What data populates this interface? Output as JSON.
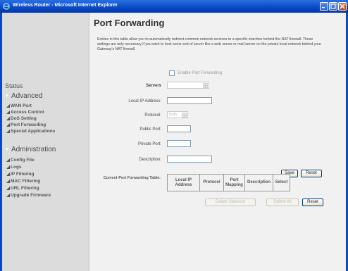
{
  "window": {
    "title": "Wireless Router - Microsoft Internet Explorer"
  },
  "sidebar": {
    "status_label": "Status",
    "advanced": {
      "label": "Advanced",
      "items": [
        "WAN Port",
        "Access Control",
        "DoS Setting",
        "Port Forwarding",
        "Special Applications"
      ]
    },
    "administration": {
      "label": "Administration",
      "items": [
        "Config File",
        "Logs",
        "IP Filtering",
        "MAC Filtering",
        "URL Filtering",
        "Upgrade Firmware"
      ]
    }
  },
  "main": {
    "title": "Port Forwarding",
    "description": "Entries in this table allow you to automatically redirect common network services to a specific machine behind the NAT firewall. These settings are only necessary if you wish to host some sort of server like a web server or mail server on the private local network behind your Gateway's NAT firewall.",
    "enable_label": "Enable Port Forwarding",
    "enable_checked": false,
    "form": {
      "servers_label": "Servers",
      "servers_value": "",
      "local_ip_label": "Local IP Address:",
      "local_ip_value": "",
      "protocol_label": "Protocol:",
      "protocol_value": "Both",
      "public_port_label": "Public Port:",
      "public_port_value": "",
      "private_port_label": "Private Port:",
      "private_port_value": "",
      "description_label": "Description:",
      "description_value": ""
    },
    "save_label": "Save",
    "reset_label": "Reset",
    "table": {
      "label": "Current Port Forwarding Table:",
      "columns": [
        "Local IP Address",
        "Protocol",
        "Port Mapping",
        "Description",
        "Select"
      ]
    },
    "delete_selected_label": "Delete Selected",
    "delete_all_label": "Delete All",
    "table_reset_label": "Reset"
  },
  "colors": {
    "titlebar": "#0a4ac7",
    "sidebar_bg": "#dcdcdc",
    "content_bg": "#f1f1f1",
    "close_button": "#c6401f"
  }
}
